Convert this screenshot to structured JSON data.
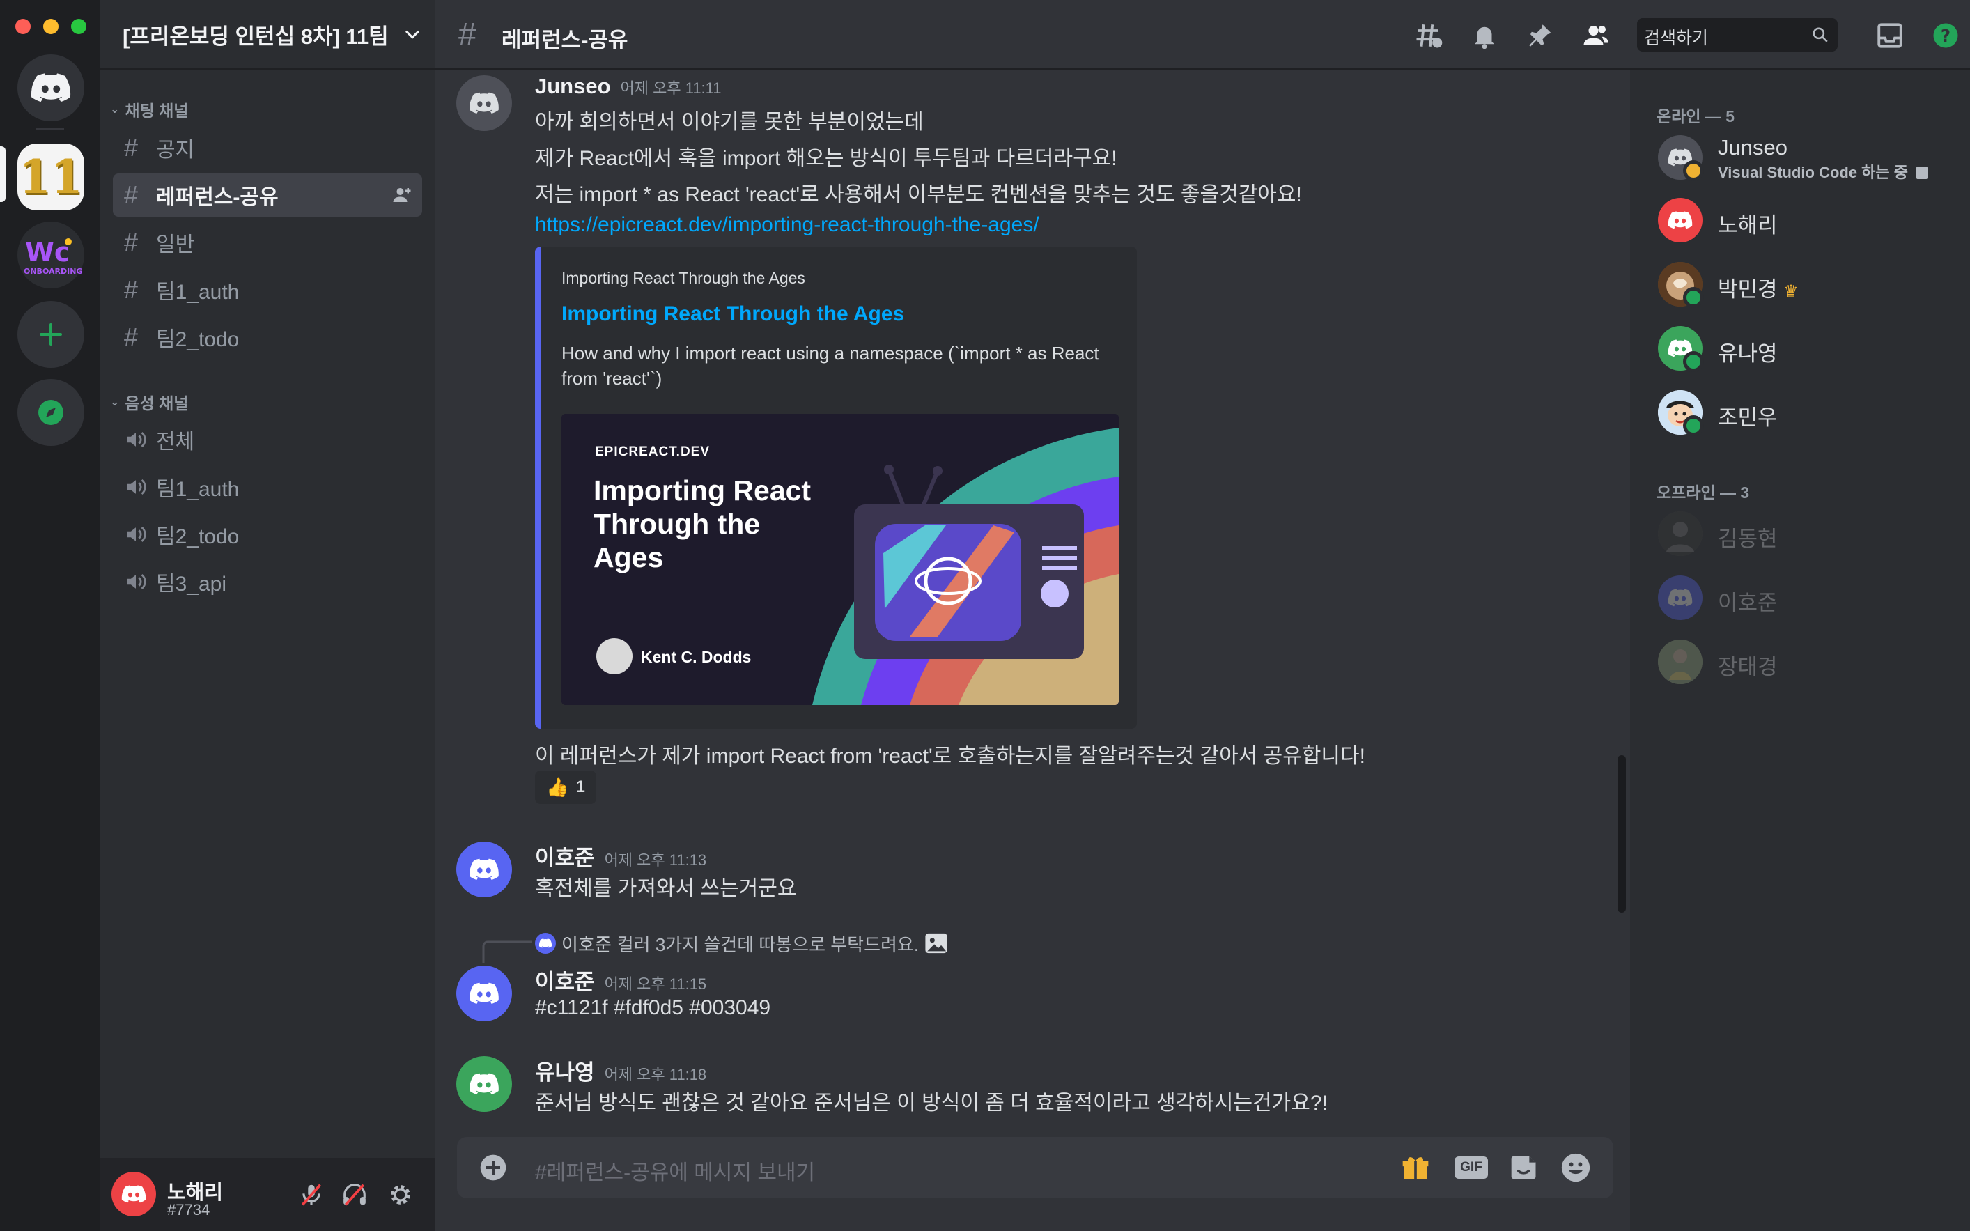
{
  "server": {
    "name": "[프리온보딩 인턴십 8차] 11팀",
    "rail_badge": "11"
  },
  "categories": {
    "text": "채팅 채널",
    "voice": "음성 채널"
  },
  "text_channels": [
    {
      "name": "공지"
    },
    {
      "name": "레퍼런스-공유"
    },
    {
      "name": "일반"
    },
    {
      "name": "팀1_auth"
    },
    {
      "name": "팀2_todo"
    }
  ],
  "voice_channels": [
    {
      "name": "전체"
    },
    {
      "name": "팀1_auth"
    },
    {
      "name": "팀2_todo"
    },
    {
      "name": "팀3_api"
    }
  ],
  "header": {
    "channel": "레퍼런스-공유",
    "search_placeholder": "검색하기"
  },
  "messages": {
    "m1": {
      "author": "Junseo",
      "time": "어제 오후 11:11",
      "lines": [
        "아까 회의하면서 이야기를 못한 부분이었는데",
        "제가 React에서 훅을 import 해오는 방식이 투두팀과 다르더라구요!",
        "저는 import * as React 'react'로 사용해서 이부분도 컨벤션을 맞추는 것도 좋을것같아요!"
      ],
      "link": "https://epicreact.dev/importing-react-through-the-ages/",
      "embed": {
        "site": "Importing React Through the Ages",
        "title": "Importing React Through the Ages",
        "desc1": "How and why I import react using a namespace (`import * as React",
        "desc2": "from 'react'`)",
        "img_site": "EPICREACT.DEV",
        "img_title1": "Importing React",
        "img_title2": "Through the",
        "img_title3": "Ages",
        "img_author": "Kent C. Dodds"
      },
      "followup": "이 레퍼런스가 제가  import React from 'react'로 호출하는지를 잘알려주는것 같아서 공유합니다!",
      "reaction": {
        "emoji": "👍",
        "count": "1"
      }
    },
    "m2": {
      "author": "이호준",
      "time": "어제 오후 11:13",
      "text": "혹전체를 가져와서 쓰는거군요"
    },
    "m3": {
      "reply_author": "이호준",
      "reply_text": "컬러 3가지 쓸건데 따봉으로 부탁드려요.",
      "author": "이호준",
      "time": "어제 오후 11:15",
      "text": "#c1121f #fdf0d5 #003049"
    },
    "m4": {
      "author": "유나영",
      "time": "어제 오후 11:18",
      "text": "준서님 방식도 괜찮은 것 같아요 준서님은 이 방식이 좀 더 효율적이라고 생각하시는건가요?!"
    }
  },
  "input": {
    "placeholder": "#레퍼런스-공유에 메시지 보내기",
    "gif_label": "GIF"
  },
  "members": {
    "online_header": "온라인 — 5",
    "offline_header": "오프라인 — 3",
    "online": [
      {
        "name": "Junseo",
        "activity": "Visual Studio Code 하는 중"
      },
      {
        "name": "노해리"
      },
      {
        "name": "박민경"
      },
      {
        "name": "유나영"
      },
      {
        "name": "조민우"
      }
    ],
    "offline": [
      {
        "name": "김동현"
      },
      {
        "name": "이호준"
      },
      {
        "name": "장태경"
      }
    ]
  },
  "user": {
    "name": "노해리",
    "tag": "#7734"
  },
  "colors": {
    "blurple": "#5865f2",
    "red": "#ed4245",
    "green": "#3ba55c",
    "link": "#00a8fc"
  }
}
